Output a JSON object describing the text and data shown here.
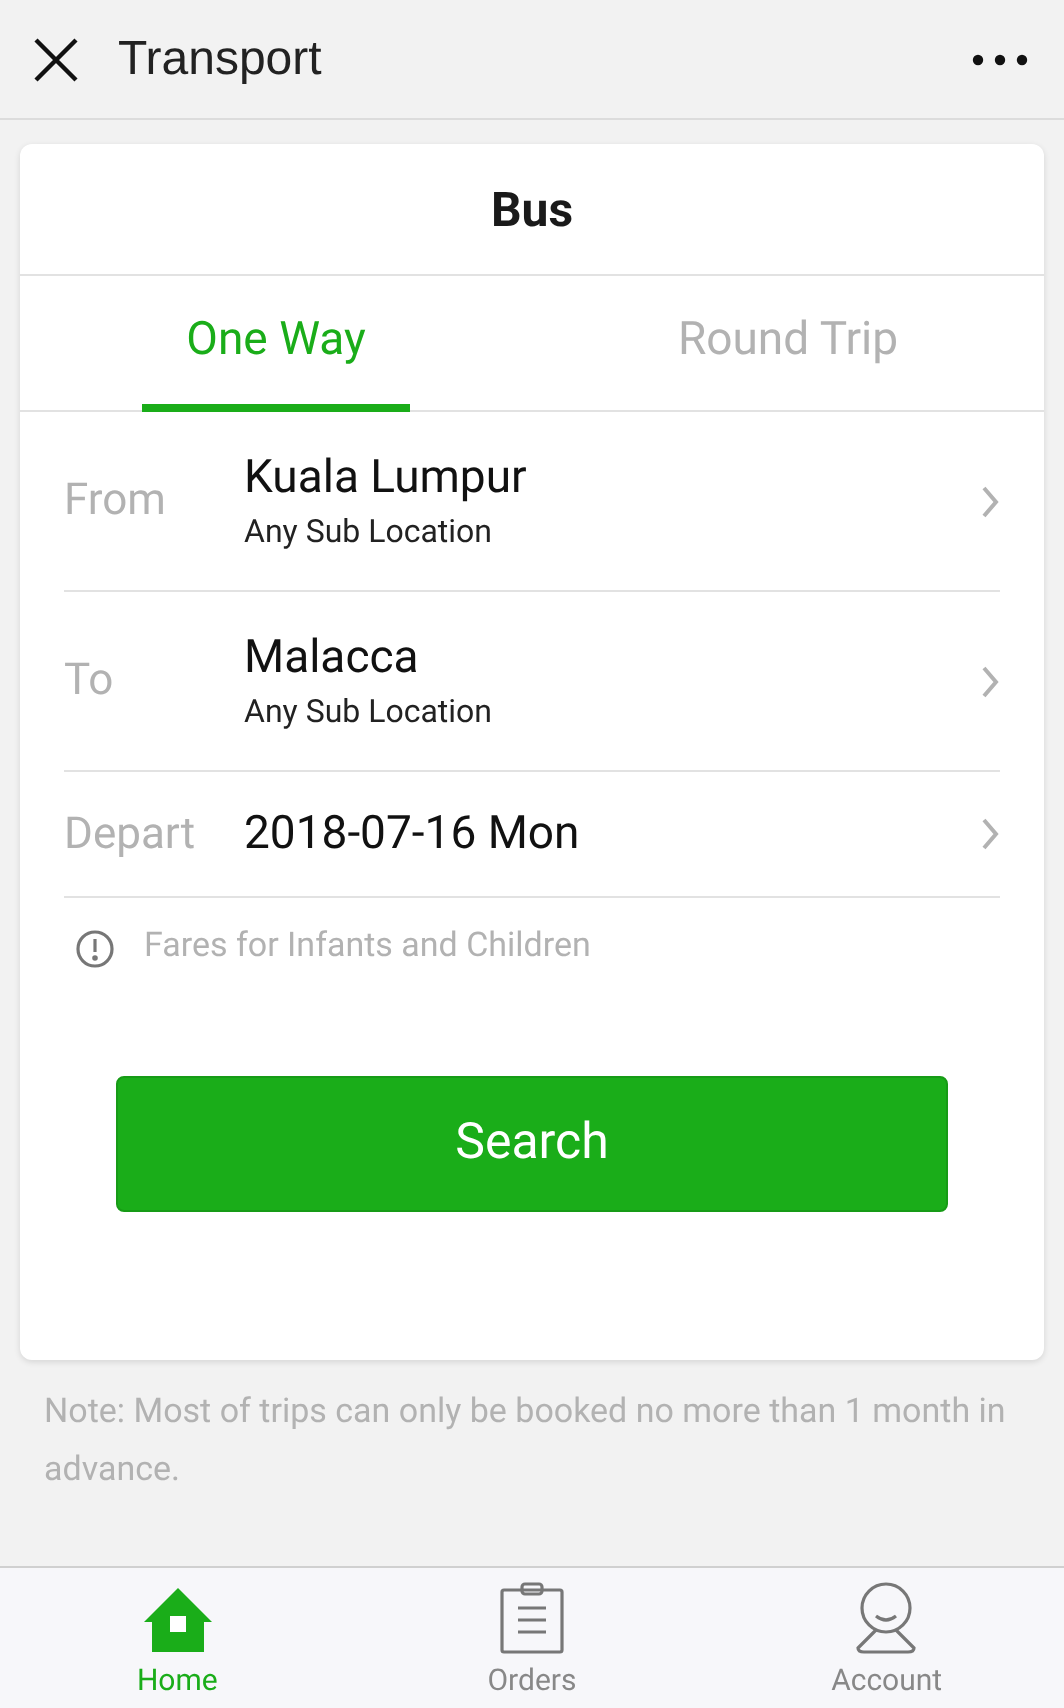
{
  "header": {
    "title": "Transport"
  },
  "card": {
    "title": "Bus",
    "tabs": [
      {
        "label": "One Way",
        "selected": true
      },
      {
        "label": "Round Trip",
        "selected": false
      }
    ],
    "fields": [
      {
        "kind": "location",
        "label": "From",
        "value": "Kuala Lumpur",
        "sub": "Any Sub Location"
      },
      {
        "kind": "location",
        "label": "To",
        "value": "Malacca",
        "sub": "Any Sub Location"
      },
      {
        "kind": "date",
        "label": "Depart",
        "value": "2018-07-16 Mon"
      }
    ],
    "info": "Fares for Infants and Children",
    "button": "Search"
  },
  "note": "Note: Most of trips can only be booked no more than 1 month in advance.",
  "nav": [
    {
      "kind": "home",
      "label": "Home",
      "selected": true
    },
    {
      "kind": "orders",
      "label": "Orders",
      "selected": false
    },
    {
      "kind": "account",
      "label": "Account",
      "selected": false
    }
  ]
}
